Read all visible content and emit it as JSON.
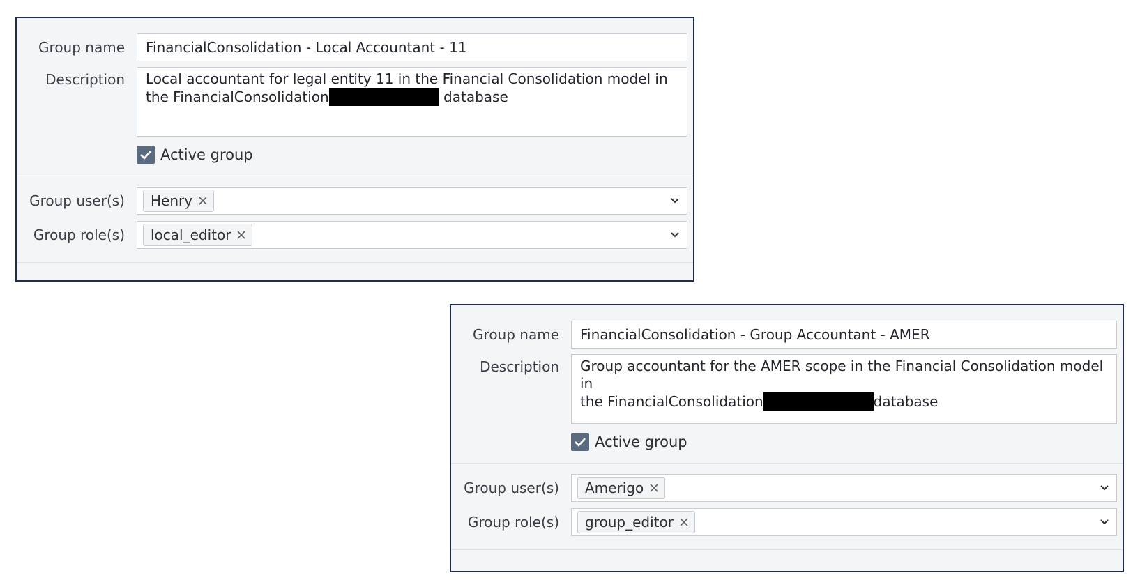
{
  "panels": [
    {
      "group_name_label": "Group name",
      "group_name_value": "FinancialConsolidation - Local Accountant - 11",
      "description_label": "Description",
      "description_line1": "Local accountant for legal entity 11 in the Financial Consolidation model in",
      "description_line2_start": "the FinancialConsolidation",
      "description_line2_end": " database",
      "active_label": "Active group",
      "active_checked": true,
      "users_label": "Group user(s)",
      "users": [
        "Henry"
      ],
      "roles_label": "Group role(s)",
      "roles": [
        "local_editor"
      ]
    },
    {
      "group_name_label": "Group name",
      "group_name_value": "FinancialConsolidation - Group Accountant - AMER",
      "description_label": "Description",
      "description_line1": "Group accountant for the AMER scope in the Financial Consolidation model in",
      "description_line2_start": "the FinancialConsolidation",
      "description_line2_end": "database",
      "active_label": "Active group",
      "active_checked": true,
      "users_label": "Group user(s)",
      "users": [
        "Amerigo"
      ],
      "roles_label": "Group role(s)",
      "roles": [
        "group_editor"
      ]
    }
  ],
  "icons": {
    "checkbox": "check-icon",
    "chip_remove": "close-icon",
    "dropdown": "chevron-down-icon"
  },
  "colors": {
    "panel_border": "#1f2d4d",
    "panel_bg": "#f4f5f7",
    "checkbox_fill": "#5b6b7f",
    "redaction": "#000000"
  }
}
